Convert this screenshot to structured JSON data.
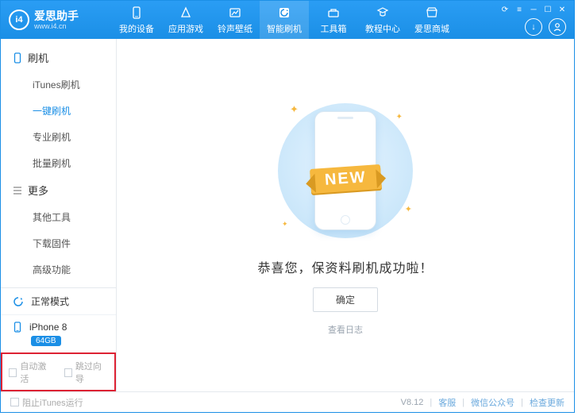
{
  "brand": {
    "title": "爱思助手",
    "sub": "www.i4.cn",
    "logoText": "i4"
  },
  "nav": {
    "items": [
      {
        "label": "我的设备"
      },
      {
        "label": "应用游戏"
      },
      {
        "label": "铃声壁纸"
      },
      {
        "label": "智能刷机",
        "active": true
      },
      {
        "label": "工具箱"
      },
      {
        "label": "教程中心"
      },
      {
        "label": "爱思商城"
      }
    ]
  },
  "sidebar": {
    "groups": [
      {
        "title": "刷机",
        "items": [
          {
            "label": "iTunes刷机"
          },
          {
            "label": "一键刷机",
            "active": true
          },
          {
            "label": "专业刷机"
          },
          {
            "label": "批量刷机"
          }
        ]
      },
      {
        "title": "更多",
        "items": [
          {
            "label": "其他工具"
          },
          {
            "label": "下载固件"
          },
          {
            "label": "高级功能"
          }
        ]
      }
    ],
    "mode": "正常模式",
    "device": {
      "name": "iPhone 8",
      "storage": "64GB"
    },
    "opts": {
      "autoActivate": "自动激活",
      "skipGuide": "跳过向导"
    }
  },
  "main": {
    "ribbon": "NEW",
    "message": "恭喜您，保资料刷机成功啦！",
    "confirm": "确定",
    "viewLog": "查看日志"
  },
  "footer": {
    "blockItunes": "阻止iTunes运行",
    "version": "V8.12",
    "support": "客服",
    "wechat": "微信公众号",
    "update": "检查更新"
  }
}
